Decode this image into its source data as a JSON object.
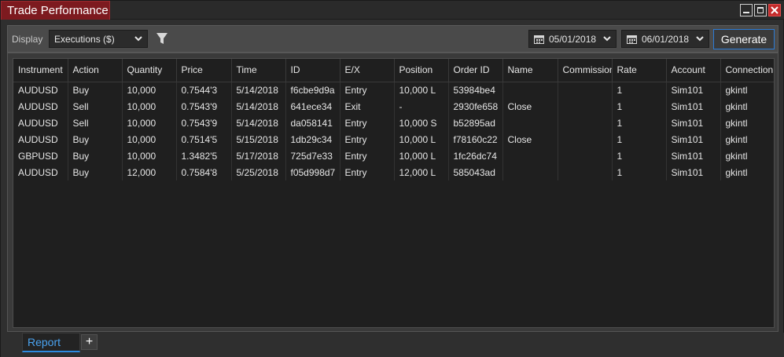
{
  "window": {
    "title": "Trade Performance"
  },
  "toolbar": {
    "display_label": "Display",
    "display_value": "Executions ($)",
    "date_from": "05/01/2018",
    "date_to": "06/01/2018",
    "generate_label": "Generate"
  },
  "grid": {
    "columns": [
      "Instrument",
      "Action",
      "Quantity",
      "Price",
      "Time",
      "ID",
      "E/X",
      "Position",
      "Order ID",
      "Name",
      "Commission",
      "Rate",
      "Account",
      "Connection"
    ],
    "rows": [
      [
        "AUDUSD",
        "Buy",
        "10,000",
        "0.7544'3",
        "5/14/2018",
        "f6cbe9d9a",
        "Entry",
        "10,000 L",
        "53984be4",
        "",
        "",
        "1",
        "Sim101",
        "gkintl"
      ],
      [
        "AUDUSD",
        "Sell",
        "10,000",
        "0.7543'9",
        "5/14/2018",
        "641ece34",
        "Exit",
        "-",
        "2930fe658",
        "Close",
        "",
        "1",
        "Sim101",
        "gkintl"
      ],
      [
        "AUDUSD",
        "Sell",
        "10,000",
        "0.7543'9",
        "5/14/2018",
        "da058141",
        "Entry",
        "10,000 S",
        "b52895ad",
        "",
        "",
        "1",
        "Sim101",
        "gkintl"
      ],
      [
        "AUDUSD",
        "Buy",
        "10,000",
        "0.7514'5",
        "5/15/2018",
        "1db29c34",
        "Entry",
        "10,000 L",
        "f78160c22",
        "Close",
        "",
        "1",
        "Sim101",
        "gkintl"
      ],
      [
        "GBPUSD",
        "Buy",
        "10,000",
        "1.3482'5",
        "5/17/2018",
        "725d7e33",
        "Entry",
        "10,000 L",
        "1fc26dc74",
        "",
        "",
        "1",
        "Sim101",
        "gkintl"
      ],
      [
        "AUDUSD",
        "Buy",
        "12,000",
        "0.7584'8",
        "5/25/2018",
        "f05d998d7",
        "Entry",
        "12,000 L",
        "585043ad",
        "",
        "",
        "1",
        "Sim101",
        "gkintl"
      ]
    ]
  },
  "tabs": {
    "report_label": "Report",
    "add_label": "+"
  },
  "colors": {
    "title_accent": "#7d1a1f",
    "active_tab": "#4aa3f0",
    "button_border": "#2c7bd6"
  }
}
